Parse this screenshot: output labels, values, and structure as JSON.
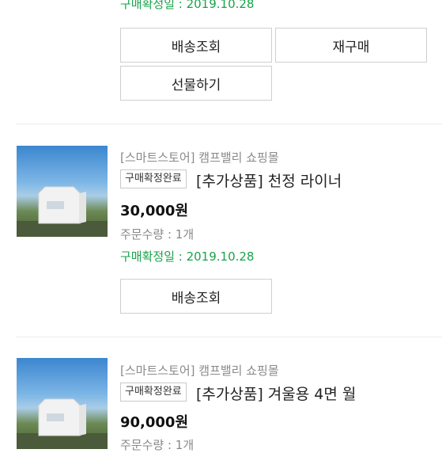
{
  "top": {
    "confirm_date": "구매확정일 : 2019.10.28",
    "buttons": {
      "delivery": "배송조회",
      "rebuy": "재구매",
      "gift": "선물하기"
    }
  },
  "orders": [
    {
      "store": "[스마트스토어] 캠프밸리 쇼핑몰",
      "badge": "구매확정완료",
      "name": "[추가상품] 천정 라이너",
      "price": "30,000원",
      "qty": "주문수량 : 1개",
      "confirm_date": "구매확정일 : 2019.10.28",
      "buttons": {
        "delivery": "배송조회"
      }
    },
    {
      "store": "[스마트스토어] 캠프밸리 쇼핑몰",
      "badge": "구매확정완료",
      "name": "[추가상품] 겨울용 4면 월",
      "price": "90,000원",
      "qty": "주문수량 : 1개"
    }
  ],
  "colors": {
    "confirm": "#1aa34a",
    "border": "#cfcfcf"
  }
}
